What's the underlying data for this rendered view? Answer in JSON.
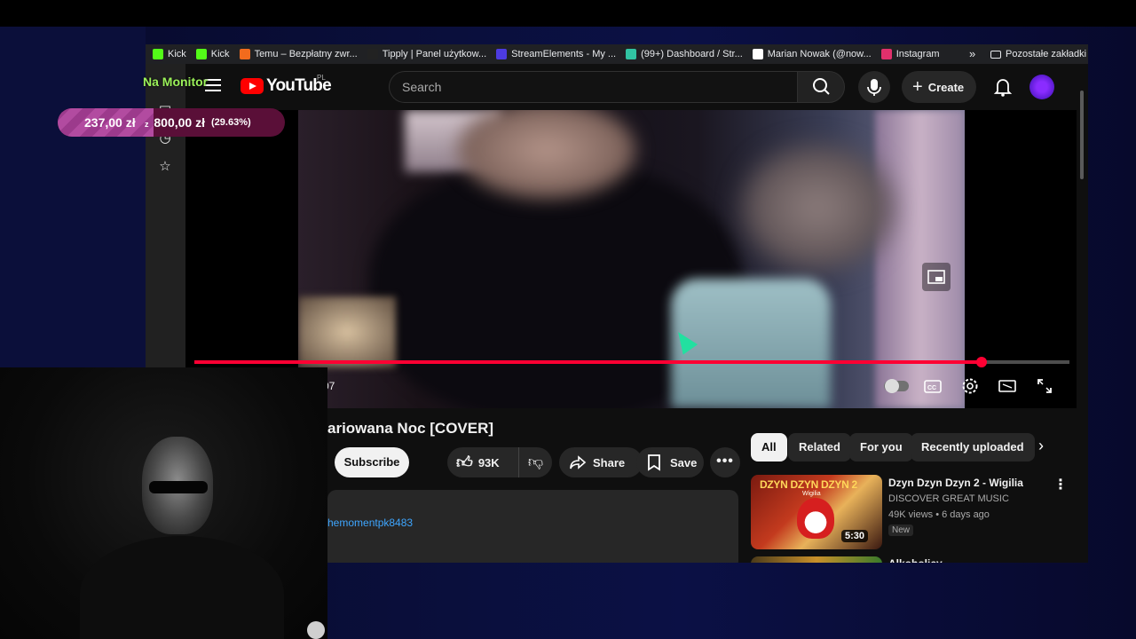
{
  "bookmarks": {
    "items": [
      {
        "label": "Kick",
        "icon": "kick-icon",
        "color": "#53fc18"
      },
      {
        "label": "Kick",
        "icon": "kick-icon",
        "color": "#53fc18"
      },
      {
        "label": "Temu – Bezpłatny zwr...",
        "icon": "temu-icon",
        "color": "#f26b1d"
      },
      {
        "label": "Tipply | Panel użytkow...",
        "icon": "tipply-icon",
        "color": "#222222"
      },
      {
        "label": "StreamElements - My ...",
        "icon": "streamelements-icon",
        "color": "#4d3be0"
      },
      {
        "label": "(99+) Dashboard / Str...",
        "icon": "streamlabs-icon",
        "color": "#31c3a2"
      },
      {
        "label": "Marian Nowak (@now...",
        "icon": "x-icon",
        "color": "#ffffff"
      },
      {
        "label": "Instagram",
        "icon": "instagram-icon",
        "color": "#e1306c"
      }
    ],
    "more_glyph": "»",
    "other_folder": "Pozostałe zakładki"
  },
  "header": {
    "logo_text": "YouTube",
    "country_code": "PL",
    "search_placeholder": "Search",
    "create_label": "Create"
  },
  "player": {
    "progress": 0.9,
    "time_text": "07",
    "accent": "#ff0033"
  },
  "video": {
    "title": "ariowana Noc [COVER]",
    "subscribe_label": "Subscribe",
    "likes": "93K",
    "share_label": "Share",
    "save_label": "Save",
    "description_link": "hemomentpk8483"
  },
  "chips": [
    "All",
    "Related",
    "For you",
    "Recently uploaded"
  ],
  "recommendation": {
    "thumb_title": "DZYN DZYN DZYN 2",
    "thumb_subtitle": "Wigilia",
    "duration": "5:30",
    "title": "Dzyn Dzyn Dzyn 2 - Wigilia",
    "channel": "DISCOVER GREAT MUSIC",
    "meta": "49K views • 6 days ago",
    "badge": "New",
    "next_title": "Alkoholicy"
  },
  "overlay": {
    "goal_label": "Na Monitor",
    "goal_current": "237,00 zł",
    "goal_separator": "z",
    "goal_target": "800,00 zł",
    "goal_percent": "(29.63%)",
    "goal_fraction": 0.2963
  }
}
